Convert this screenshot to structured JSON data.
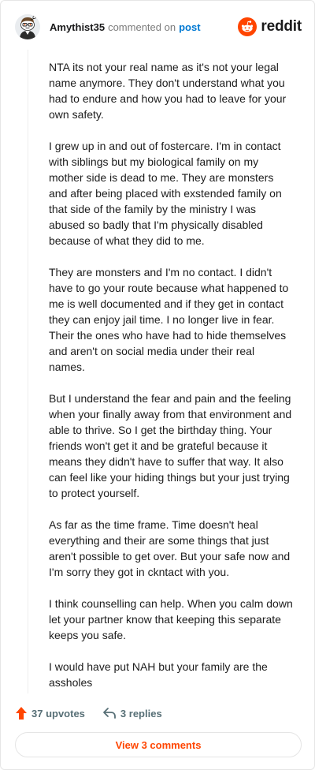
{
  "header": {
    "username": "Amythist35",
    "commented_text": "commented on",
    "post_link": "post",
    "brand": "reddit"
  },
  "comment": {
    "paragraphs": [
      "NTA its not your real name as it's not your legal name anymore. They don't understand what you had to endure and how you had to leave for your own safety.",
      "I grew up in and out of fostercare. I'm in contact with siblings but my biological family on my mother side is dead to me. They are monsters and after being placed with exstended family on that side of the family by the ministry I was abused so badly that I'm physically disabled because of what they did to me.",
      "They are monsters and I'm no contact. I didn't have to go your route because what happened to me is well documented and if they get in contact they can enjoy jail time. I no longer live in fear. Their the ones who have had to hide themselves and aren't on social media under their real names.",
      "But I understand the fear and pain and the feeling when your finally away from that environment and able to thrive. So I get the birthday thing. Your friends won't get it and be grateful because it means they didn't have to suffer that way. It also can feel like your hiding things but your just trying to protect yourself.",
      "As far as the time frame. Time doesn't heal everything and their are some things that just aren't possible to get over. But your safe now and I'm sorry they got in ckntact with you.",
      "I think counselling can help. When you calm down let your partner know that keeping this separate keeps you safe.",
      "I would have put NAH but your family are the assholes"
    ]
  },
  "footer": {
    "upvotes_label": "37 upvotes",
    "replies_label": "3 replies",
    "view_comments_label": "View 3 comments"
  },
  "colors": {
    "accent": "#ff4500",
    "link": "#0079d3",
    "muted": "#576f76"
  },
  "icons": {
    "avatar": "snoo-avatar",
    "brand": "reddit-logo-icon",
    "upvote": "upvote-arrow-icon",
    "reply": "reply-arrow-icon"
  }
}
